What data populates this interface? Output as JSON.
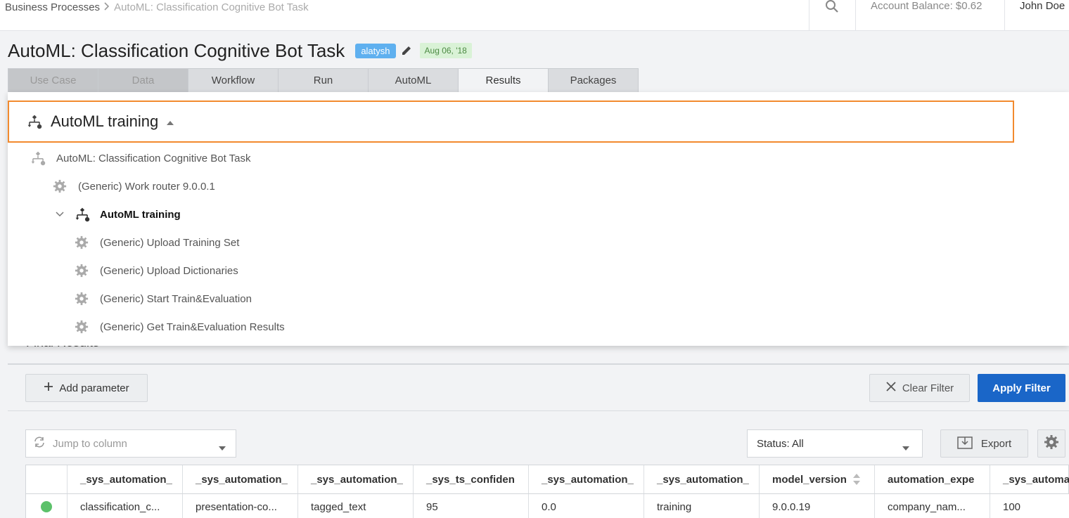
{
  "breadcrumb": {
    "parent": "Business Processes",
    "separator": ">",
    "current": "AutoML: Classification Cognitive Bot Task"
  },
  "topbar": {
    "balance": "Account Balance: $0.62",
    "user": "John Doe"
  },
  "page": {
    "title": "AutoML: Classification Cognitive Bot Task",
    "owner_badge": "alatysh",
    "date_badge": "Aug 06, '18"
  },
  "tabs": [
    {
      "label": "Use Case",
      "state": "disabled"
    },
    {
      "label": "Data",
      "state": "disabled"
    },
    {
      "label": "Workflow",
      "state": "normal"
    },
    {
      "label": "Run",
      "state": "normal"
    },
    {
      "label": "AutoML",
      "state": "normal"
    },
    {
      "label": "Results",
      "state": "active"
    },
    {
      "label": "Packages",
      "state": "normal"
    }
  ],
  "workflow_dropdown": {
    "selected": "AutoML training",
    "tree": [
      {
        "label": "AutoML: Classification Cognitive Bot Task",
        "icon": "workflow-icon"
      },
      {
        "label": "(Generic) Work router 9.0.0.1",
        "icon": "gear-icon"
      },
      {
        "label": "AutoML training",
        "icon": "workflow-icon",
        "expanded": true
      },
      {
        "label": "(Generic) Upload Training Set",
        "icon": "gear-icon"
      },
      {
        "label": "(Generic) Upload Dictionaries",
        "icon": "gear-icon"
      },
      {
        "label": "(Generic) Start Train&Evaluation",
        "icon": "gear-icon"
      },
      {
        "label": "(Generic) Get Train&Evaluation Results",
        "icon": "gear-icon"
      }
    ]
  },
  "results": {
    "section_title": "Final Results",
    "add_parameter": "Add parameter",
    "clear_filter": "Clear Filter",
    "apply_filter": "Apply Filter",
    "jump_placeholder": "Jump to column",
    "status_filter": "Status: All",
    "export": "Export"
  },
  "table": {
    "columns": [
      "",
      "_sys_automation_",
      "_sys_automation_",
      "_sys_automation_",
      "_sys_ts_confiden",
      "_sys_automation_",
      "_sys_automation_",
      "model_version",
      "automation_expe",
      "_sys_automa"
    ],
    "rows": [
      [
        "",
        "classification_c...",
        "presentation-co...",
        "tagged_text",
        "95",
        "0.0",
        "training",
        "9.0.0.19",
        "company_nam...",
        "100"
      ]
    ],
    "row_status_color": "#5cc16a"
  },
  "colors": {
    "accent": "#1a66c8",
    "highlight": "#f28a2e",
    "owner_badge": "#5fb0ef",
    "date_badge_bg": "#d9f2d6"
  }
}
